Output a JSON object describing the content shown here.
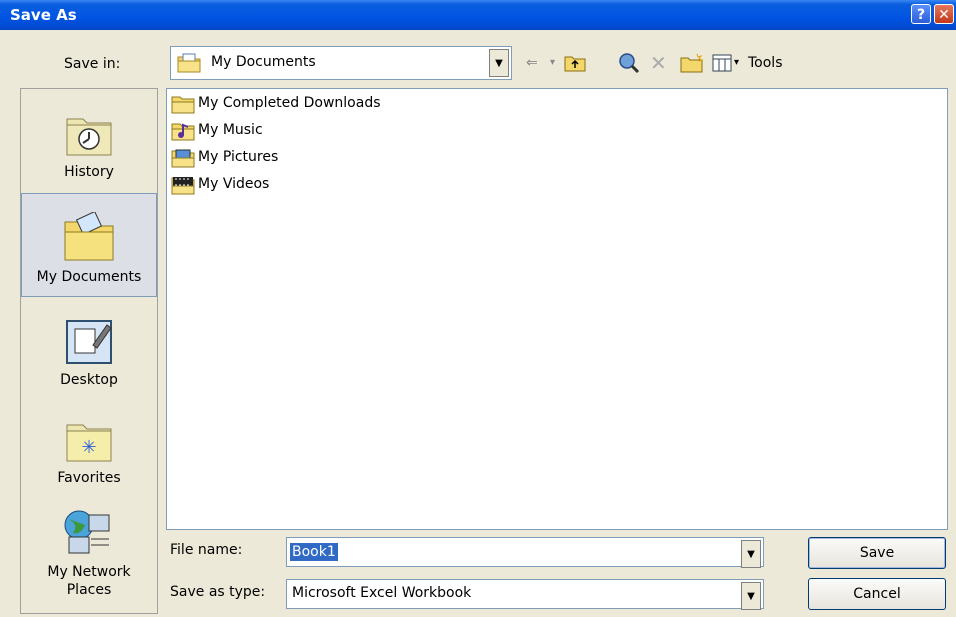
{
  "window": {
    "title": "Save As",
    "help_glyph": "?",
    "close_glyph": "✕"
  },
  "save_in": {
    "label": "Save in:",
    "value": "My Documents"
  },
  "toolbar": {
    "tools_label": "Tools ▾"
  },
  "places": [
    {
      "label": "History",
      "icon": "history-icon"
    },
    {
      "label": "My Documents",
      "icon": "my-documents-icon"
    },
    {
      "label": "Desktop",
      "icon": "desktop-icon"
    },
    {
      "label": "Favorites",
      "icon": "favorites-icon"
    },
    {
      "label_line1": "My Network",
      "label_line2": "Places",
      "icon": "network-places-icon"
    }
  ],
  "files": [
    {
      "name": "My Completed Downloads",
      "icon": "folder-icon"
    },
    {
      "name": "My Music",
      "icon": "music-folder-icon"
    },
    {
      "name": "My Pictures",
      "icon": "pictures-folder-icon"
    },
    {
      "name": "My Videos",
      "icon": "videos-folder-icon"
    }
  ],
  "file_name": {
    "label": "File name:",
    "value": "Book1"
  },
  "save_as_type": {
    "label": "Save as type:",
    "value": "Microsoft Excel Workbook"
  },
  "buttons": {
    "save": "Save",
    "cancel": "Cancel"
  },
  "colors": {
    "titlebar": "#0054e3",
    "selection": "#316ac5",
    "dialog_bg": "#ece9d8"
  }
}
